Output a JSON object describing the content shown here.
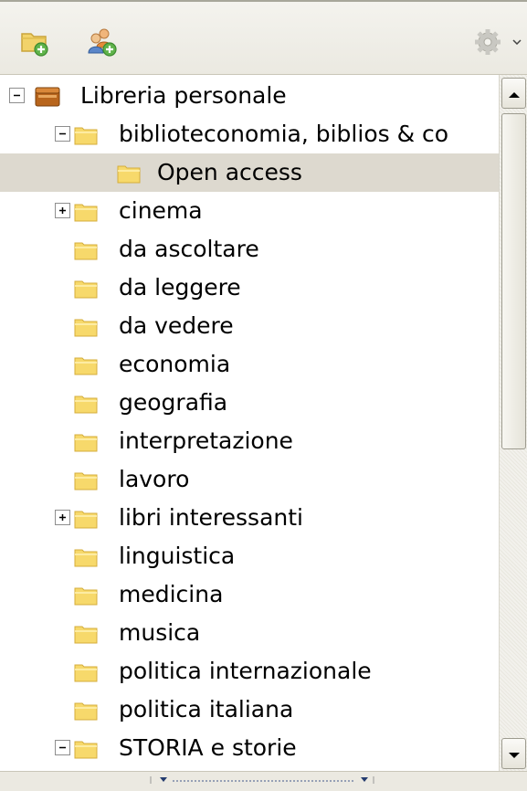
{
  "toolbar": {
    "new_collection_icon": "folder-add-icon",
    "new_group_icon": "group-add-icon",
    "actions_icon": "gear-icon"
  },
  "tree": {
    "rows": [
      {
        "label": "Libreria personale",
        "level": 0,
        "twisty": "minus",
        "icon": "library-icon"
      },
      {
        "label": "biblioteconomia, biblios & co",
        "level": 1,
        "twisty": "minus",
        "icon": "folder-icon"
      },
      {
        "label": "Open access",
        "level": 2,
        "twisty": "none",
        "icon": "folder-icon",
        "selected": true
      },
      {
        "label": "cinema",
        "level": 1,
        "twisty": "plus",
        "icon": "folder-icon"
      },
      {
        "label": "da ascoltare",
        "level": 1,
        "twisty": "none",
        "icon": "folder-icon"
      },
      {
        "label": "da leggere",
        "level": 1,
        "twisty": "none",
        "icon": "folder-icon"
      },
      {
        "label": "da vedere",
        "level": 1,
        "twisty": "none",
        "icon": "folder-icon"
      },
      {
        "label": "economia",
        "level": 1,
        "twisty": "none",
        "icon": "folder-icon"
      },
      {
        "label": "geografia",
        "level": 1,
        "twisty": "none",
        "icon": "folder-icon"
      },
      {
        "label": "interpretazione",
        "level": 1,
        "twisty": "none",
        "icon": "folder-icon"
      },
      {
        "label": "lavoro",
        "level": 1,
        "twisty": "none",
        "icon": "folder-icon"
      },
      {
        "label": "libri interessanti",
        "level": 1,
        "twisty": "plus",
        "icon": "folder-icon"
      },
      {
        "label": "linguistica",
        "level": 1,
        "twisty": "none",
        "icon": "folder-icon"
      },
      {
        "label": "medicina",
        "level": 1,
        "twisty": "none",
        "icon": "folder-icon"
      },
      {
        "label": "musica",
        "level": 1,
        "twisty": "none",
        "icon": "folder-icon"
      },
      {
        "label": "politica internazionale",
        "level": 1,
        "twisty": "none",
        "icon": "folder-icon"
      },
      {
        "label": "politica italiana",
        "level": 1,
        "twisty": "none",
        "icon": "folder-icon"
      },
      {
        "label": "STORIA e storie",
        "level": 1,
        "twisty": "minus",
        "icon": "folder-icon"
      }
    ]
  },
  "colors": {
    "selection": "#ddd9cf",
    "folder": "#f7d96b",
    "toolbar": "#ebe9e1"
  }
}
